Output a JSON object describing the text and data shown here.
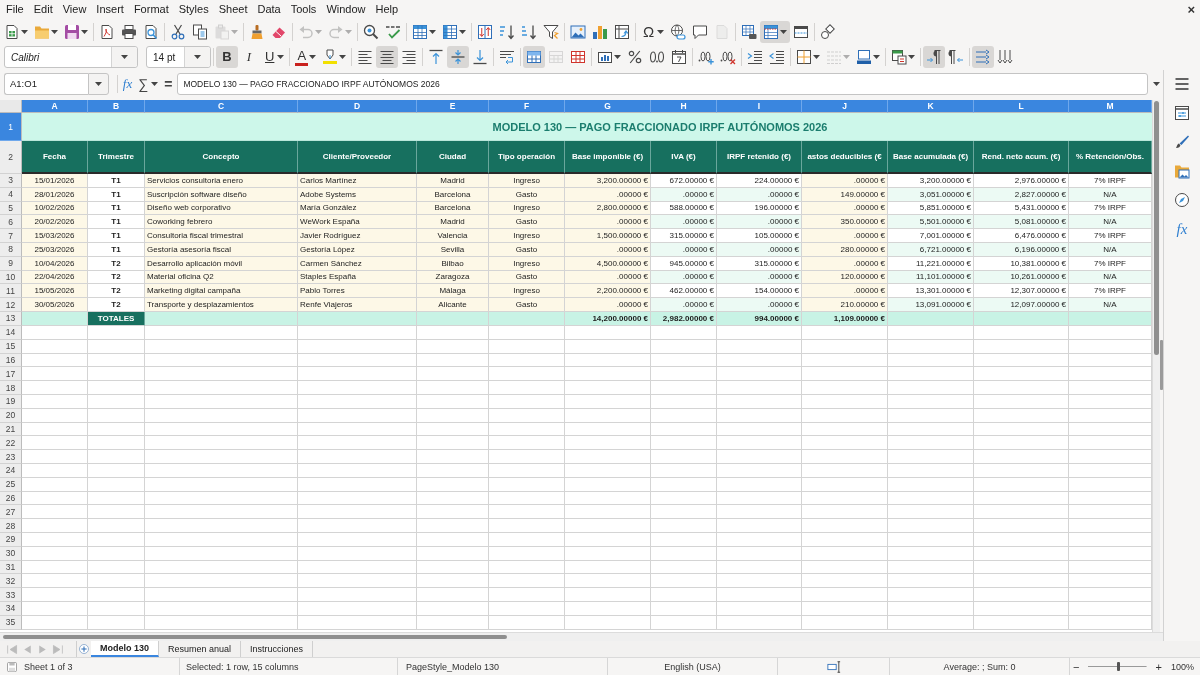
{
  "menu_bar": {
    "items": [
      "File",
      "Edit",
      "View",
      "Insert",
      "Format",
      "Styles",
      "Sheet",
      "Data",
      "Tools",
      "Window",
      "Help"
    ],
    "close": "×"
  },
  "toolbar_standard": [
    [
      {
        "kind": "new",
        "dropdown": true,
        "pressed": false,
        "disabled": false
      },
      {
        "kind": "open",
        "dropdown": true,
        "pressed": false,
        "disabled": false
      },
      {
        "kind": "save",
        "dropdown": true,
        "pressed": false,
        "disabled": false
      }
    ],
    [
      {
        "kind": "export_pdf",
        "dropdown": false,
        "pressed": false,
        "disabled": false
      },
      {
        "kind": "print",
        "dropdown": false,
        "pressed": false,
        "disabled": false
      },
      {
        "kind": "print_preview",
        "dropdown": false,
        "pressed": false,
        "disabled": false
      }
    ],
    [
      {
        "kind": "cut",
        "dropdown": false,
        "pressed": false,
        "disabled": false
      },
      {
        "kind": "copy",
        "dropdown": false,
        "pressed": false,
        "disabled": false
      },
      {
        "kind": "paste",
        "dropdown": true,
        "pressed": false,
        "disabled": true
      }
    ],
    [
      {
        "kind": "clone_formatting",
        "dropdown": false,
        "pressed": false,
        "disabled": false
      },
      {
        "kind": "clear_formatting",
        "dropdown": false,
        "pressed": false,
        "disabled": false
      }
    ],
    [
      {
        "kind": "undo",
        "dropdown": true,
        "pressed": false,
        "disabled": true
      },
      {
        "kind": "redo",
        "dropdown": true,
        "pressed": false,
        "disabled": true
      }
    ],
    [
      {
        "kind": "find_replace",
        "dropdown": false,
        "pressed": false,
        "disabled": false
      },
      {
        "kind": "spelling",
        "dropdown": false,
        "pressed": false,
        "disabled": false
      }
    ],
    [
      {
        "kind": "insert_rows",
        "dropdown": true,
        "pressed": false,
        "disabled": false
      },
      {
        "kind": "insert_columns",
        "dropdown": true,
        "pressed": false,
        "disabled": false
      }
    ],
    [
      {
        "kind": "sort",
        "dropdown": false,
        "pressed": false,
        "disabled": false
      },
      {
        "kind": "sort_ascending",
        "dropdown": false,
        "pressed": false,
        "disabled": false
      },
      {
        "kind": "sort_descending",
        "dropdown": false,
        "pressed": false,
        "disabled": false
      },
      {
        "kind": "autofilter",
        "dropdown": false,
        "pressed": false,
        "disabled": false
      }
    ],
    [
      {
        "kind": "image",
        "dropdown": false,
        "pressed": false,
        "disabled": false
      },
      {
        "kind": "chart",
        "dropdown": false,
        "pressed": false,
        "disabled": false
      },
      {
        "kind": "pivot_table",
        "dropdown": false,
        "pressed": false,
        "disabled": false
      }
    ],
    [
      {
        "kind": "special_character",
        "glyph": "Ω",
        "dropdown": true,
        "pressed": false,
        "disabled": false
      },
      {
        "kind": "hyperlink",
        "dropdown": false,
        "pressed": false,
        "disabled": false
      },
      {
        "kind": "comment",
        "dropdown": false,
        "pressed": false,
        "disabled": false
      },
      {
        "kind": "headers_footers",
        "dropdown": false,
        "pressed": false,
        "disabled": true
      }
    ],
    [
      {
        "kind": "print_area",
        "dropdown": false,
        "pressed": false,
        "disabled": false
      },
      {
        "kind": "freeze",
        "dropdown": true,
        "pressed": true,
        "disabled": false
      },
      {
        "kind": "split_window",
        "dropdown": false,
        "pressed": false,
        "disabled": false
      }
    ],
    [
      {
        "kind": "shapes",
        "dropdown": false,
        "pressed": false,
        "disabled": false
      }
    ]
  ],
  "toolbar_formatting": {
    "font_name": "Calibri",
    "font_size": "14 pt",
    "groups": [
      [
        {
          "kind": "bold",
          "glyph": "B",
          "dropdown": false,
          "pressed": true,
          "disabled": false
        },
        {
          "kind": "italic",
          "glyph": "I",
          "dropdown": false,
          "pressed": false,
          "disabled": false
        },
        {
          "kind": "underline",
          "glyph": "U",
          "dropdown": true,
          "pressed": false,
          "disabled": false
        }
      ],
      [
        {
          "kind": "font_color",
          "glyph": "A",
          "dropdown": true,
          "pressed": false,
          "disabled": false
        },
        {
          "kind": "highlight",
          "dropdown": true,
          "pressed": false,
          "disabled": false
        }
      ],
      [
        {
          "kind": "align_left",
          "dropdown": false,
          "pressed": false,
          "disabled": false
        },
        {
          "kind": "align_center",
          "dropdown": false,
          "pressed": true,
          "disabled": false
        },
        {
          "kind": "align_right",
          "dropdown": false,
          "pressed": false,
          "disabled": false
        }
      ],
      [
        {
          "kind": "align_top",
          "dropdown": false,
          "pressed": false,
          "disabled": false
        },
        {
          "kind": "align_middle",
          "dropdown": false,
          "pressed": true,
          "disabled": false
        },
        {
          "kind": "align_bottom",
          "dropdown": false,
          "pressed": false,
          "disabled": false
        }
      ],
      [
        {
          "kind": "wrap",
          "dropdown": false,
          "pressed": false,
          "disabled": false
        }
      ],
      [
        {
          "kind": "merge_center",
          "dropdown": false,
          "pressed": true,
          "disabled": false
        },
        {
          "kind": "merge",
          "dropdown": false,
          "pressed": false,
          "disabled": true
        },
        {
          "kind": "unmerge",
          "dropdown": false,
          "pressed": false,
          "disabled": false
        }
      ],
      [
        {
          "kind": "number_format",
          "dropdown": true,
          "pressed": false,
          "disabled": false
        },
        {
          "kind": "percent",
          "dropdown": false,
          "pressed": false,
          "disabled": false
        },
        {
          "kind": "standard_format",
          "dropdown": false,
          "pressed": false,
          "disabled": false
        },
        {
          "kind": "date",
          "dropdown": false,
          "pressed": false,
          "disabled": false
        }
      ],
      [
        {
          "kind": "add_decimal",
          "dropdown": false,
          "pressed": false,
          "disabled": false
        },
        {
          "kind": "delete_decimal",
          "dropdown": false,
          "pressed": false,
          "disabled": false
        }
      ],
      [
        {
          "kind": "increase_indent",
          "dropdown": false,
          "pressed": false,
          "disabled": false
        },
        {
          "kind": "decrease_indent",
          "dropdown": false,
          "pressed": false,
          "disabled": false
        }
      ],
      [
        {
          "kind": "borders",
          "dropdown": true,
          "pressed": false,
          "disabled": false
        },
        {
          "kind": "border_style",
          "dropdown": true,
          "pressed": false,
          "disabled": true
        },
        {
          "kind": "border_color",
          "dropdown": true,
          "pressed": false,
          "disabled": false
        }
      ],
      [
        {
          "kind": "conditional",
          "dropdown": true,
          "pressed": false,
          "disabled": false
        }
      ],
      [
        {
          "kind": "left_to_right",
          "dropdown": false,
          "pressed": true,
          "disabled": false
        },
        {
          "kind": "right_to_left",
          "dropdown": false,
          "pressed": false,
          "disabled": false
        }
      ],
      [
        {
          "kind": "text_horizontal",
          "dropdown": false,
          "pressed": true,
          "disabled": false
        },
        {
          "kind": "text_vertical",
          "dropdown": false,
          "pressed": false,
          "disabled": false
        }
      ]
    ]
  },
  "formula_bar": {
    "name_box": "A1:O1",
    "function_wizard": "fx",
    "sum": "∑",
    "equals": "=",
    "content": "MODELO 130 — PAGO FRACCIONADO IRPF AUTÓNOMOS 2026"
  },
  "sheet": {
    "columns": [
      {
        "letter": "A",
        "selected": true,
        "heading": "Fecha",
        "kind": "date"
      },
      {
        "letter": "B",
        "selected": true,
        "heading": "Trimestre",
        "kind": "quarter"
      },
      {
        "letter": "C",
        "selected": true,
        "heading": "Concepto",
        "kind": "concept"
      },
      {
        "letter": "D",
        "selected": true,
        "heading": "Cliente/Proveedor",
        "kind": "party"
      },
      {
        "letter": "E",
        "selected": true,
        "heading": "Ciudad",
        "kind": "city"
      },
      {
        "letter": "F",
        "selected": true,
        "heading": "Tipo operación",
        "kind": "operation"
      },
      {
        "letter": "G",
        "selected": true,
        "heading": "Base imponible (€)",
        "kind": "base"
      },
      {
        "letter": "H",
        "selected": true,
        "heading": "IVA (€)",
        "kind": "vat"
      },
      {
        "letter": "I",
        "selected": true,
        "heading": "IRPF retenido (€)",
        "kind": "withholding"
      },
      {
        "letter": "J",
        "selected": true,
        "heading": "astos deducibles (€",
        "kind": "expense"
      },
      {
        "letter": "K",
        "selected": true,
        "heading": "Base acumulada (€)",
        "kind": "running_base"
      },
      {
        "letter": "L",
        "selected": true,
        "heading": "Rend. neto acum. (€)",
        "kind": "running_net"
      },
      {
        "letter": "M",
        "selected": true,
        "heading": "% Retención/Obs.",
        "kind": "note"
      }
    ],
    "title_row": {
      "number": "1",
      "selected": true,
      "text": "MODELO 130 — PAGO FRACCIONADO IRPF AUTÓNOMOS 2026"
    },
    "header_row": {
      "number": "2",
      "selected": false
    },
    "rows": [
      {
        "number": "3",
        "selected": false,
        "cells": [
          "15/01/2026",
          "T1",
          "Servicios consultoria enero",
          "Carlos Martínez",
          "Madrid",
          "Ingreso",
          "3,200.00000 €",
          "672.00000 €",
          "224.00000 €",
          ".00000 €",
          "3,200.00000 €",
          "2,976.00000 €",
          "7% IRPF"
        ]
      },
      {
        "number": "4",
        "selected": false,
        "cells": [
          "28/01/2026",
          "T1",
          "Suscripción software diseño",
          "Adobe Systems",
          "Barcelona",
          "Gasto",
          ".00000 €",
          ".00000 €",
          ".00000 €",
          "149.00000 €",
          "3,051.00000 €",
          "2,827.00000 €",
          "N/A"
        ]
      },
      {
        "number": "5",
        "selected": false,
        "cells": [
          "10/02/2026",
          "T1",
          "Diseño web corporativo",
          "María González",
          "Barcelona",
          "Ingreso",
          "2,800.00000 €",
          "588.00000 €",
          "196.00000 €",
          ".00000 €",
          "5,851.00000 €",
          "5,431.00000 €",
          "7% IRPF"
        ]
      },
      {
        "number": "6",
        "selected": false,
        "cells": [
          "20/02/2026",
          "T1",
          "Coworking febrero",
          "WeWork España",
          "Madrid",
          "Gasto",
          ".00000 €",
          ".00000 €",
          ".00000 €",
          "350.00000 €",
          "5,501.00000 €",
          "5,081.00000 €",
          "N/A"
        ]
      },
      {
        "number": "7",
        "selected": false,
        "cells": [
          "15/03/2026",
          "T1",
          "Consultoria fiscal trimestral",
          "Javier Rodríguez",
          "Valencia",
          "Ingreso",
          "1,500.00000 €",
          "315.00000 €",
          "105.00000 €",
          ".00000 €",
          "7,001.00000 €",
          "6,476.00000 €",
          "7% IRPF"
        ]
      },
      {
        "number": "8",
        "selected": false,
        "cells": [
          "25/03/2026",
          "T1",
          "Gestoría asesoría fiscal",
          "Gestoría López",
          "Sevilla",
          "Gasto",
          ".00000 €",
          ".00000 €",
          ".00000 €",
          "280.00000 €",
          "6,721.00000 €",
          "6,196.00000 €",
          "N/A"
        ]
      },
      {
        "number": "9",
        "selected": false,
        "cells": [
          "10/04/2026",
          "T2",
          "Desarrollo aplicación móvil",
          "Carmen Sánchez",
          "Bilbao",
          "Ingreso",
          "4,500.00000 €",
          "945.00000 €",
          "315.00000 €",
          ".00000 €",
          "11,221.00000 €",
          "10,381.00000 €",
          "7% IRPF"
        ]
      },
      {
        "number": "10",
        "selected": false,
        "cells": [
          "22/04/2026",
          "T2",
          "Material oficina Q2",
          "Staples España",
          "Zaragoza",
          "Gasto",
          ".00000 €",
          ".00000 €",
          ".00000 €",
          "120.00000 €",
          "11,101.00000 €",
          "10,261.00000 €",
          "N/A"
        ]
      },
      {
        "number": "11",
        "selected": false,
        "cells": [
          "15/05/2026",
          "T2",
          "Marketing digital campaña",
          "Pablo Torres",
          "Málaga",
          "Ingreso",
          "2,200.00000 €",
          "462.00000 €",
          "154.00000 €",
          ".00000 €",
          "13,301.00000 €",
          "12,307.00000 €",
          "7% IRPF"
        ]
      },
      {
        "number": "12",
        "selected": false,
        "cells": [
          "30/05/2026",
          "T2",
          "Transporte y desplazamientos",
          "Renfe Viajeros",
          "Alicante",
          "Gasto",
          ".00000 €",
          ".00000 €",
          ".00000 €",
          "210.00000 €",
          "13,091.00000 €",
          "12,097.00000 €",
          "N/A"
        ]
      }
    ],
    "totals_row": {
      "number": "13",
      "selected": false,
      "label": "TOTALES",
      "amounts": [
        "14,200.00000 €",
        "2,982.00000 €",
        "994.00000 €",
        "1,109.00000 €"
      ]
    },
    "empty_rows": [
      {
        "number": "14",
        "selected": false
      },
      {
        "number": "15",
        "selected": false
      },
      {
        "number": "16",
        "selected": false
      },
      {
        "number": "17",
        "selected": false
      },
      {
        "number": "18",
        "selected": false
      },
      {
        "number": "19",
        "selected": false
      },
      {
        "number": "20",
        "selected": false
      },
      {
        "number": "21",
        "selected": false
      },
      {
        "number": "22",
        "selected": false
      },
      {
        "number": "23",
        "selected": false
      },
      {
        "number": "24",
        "selected": false
      },
      {
        "number": "25",
        "selected": false
      },
      {
        "number": "26",
        "selected": false
      },
      {
        "number": "27",
        "selected": false
      },
      {
        "number": "28",
        "selected": false
      },
      {
        "number": "29",
        "selected": false
      },
      {
        "number": "30",
        "selected": false
      },
      {
        "number": "31",
        "selected": false
      },
      {
        "number": "32",
        "selected": false
      },
      {
        "number": "33",
        "selected": false
      },
      {
        "number": "34",
        "selected": false
      },
      {
        "number": "35",
        "selected": false
      }
    ]
  },
  "sheet_tabs": [
    {
      "label": "Modelo 130",
      "selected": true
    },
    {
      "label": "Resumen anual",
      "selected": false
    },
    {
      "label": "Instrucciones",
      "selected": false
    }
  ],
  "sidebar": [
    {
      "kind": "menu"
    },
    {
      "kind": "properties"
    },
    {
      "kind": "styles"
    },
    {
      "kind": "gallery"
    },
    {
      "kind": "navigator"
    },
    {
      "kind": "functions",
      "glyph": "fx"
    }
  ],
  "status_bar": {
    "sheet": "Sheet 1 of 3",
    "selection": "Selected: 1 row, 15 columns",
    "page_style": "PageStyle_Modelo 130",
    "language": "English (USA)",
    "summary": "Average: ; Sum: 0",
    "zoom": {
      "minus": "−",
      "plus": "+",
      "level": 0.5,
      "reading": "100%"
    }
  }
}
